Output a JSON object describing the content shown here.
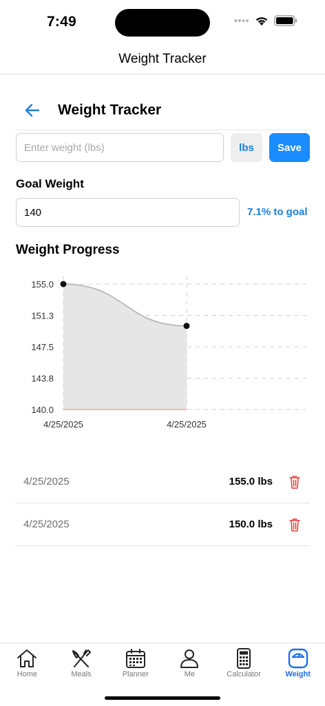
{
  "status_bar": {
    "time": "7:49"
  },
  "header": {
    "title": "Weight Tracker"
  },
  "page": {
    "title": "Weight Tracker"
  },
  "weight_entry": {
    "placeholder": "Enter weight (lbs)",
    "unit_label": "lbs",
    "save_label": "Save"
  },
  "goal": {
    "label": "Goal Weight",
    "value": "140",
    "progress_text": "7.1% to goal"
  },
  "chart_title": "Weight Progress",
  "chart_data": {
    "type": "line",
    "x": [
      "4/25/2025",
      "4/25/2025"
    ],
    "values": [
      155.0,
      150.0
    ],
    "goal_line": 140.0,
    "y_ticks": [
      "155.0",
      "151.3",
      "147.5",
      "143.8",
      "140.0"
    ],
    "ylim": [
      140.0,
      155.0
    ],
    "grid": true,
    "line_color": "#bdbdbd",
    "fill_color": "#e6e6e6",
    "point_color": "#111111",
    "goal_line_color": "#ff9a9a"
  },
  "entries": [
    {
      "date": "4/25/2025",
      "weight": "155.0 lbs"
    },
    {
      "date": "4/25/2025",
      "weight": "150.0 lbs"
    }
  ],
  "tabs": [
    {
      "label": "Home",
      "icon": "home-icon"
    },
    {
      "label": "Meals",
      "icon": "fork-knife-icon"
    },
    {
      "label": "Planner",
      "icon": "calendar-icon"
    },
    {
      "label": "Me",
      "icon": "person-icon"
    },
    {
      "label": "Calculator",
      "icon": "calculator-icon"
    },
    {
      "label": "Weight",
      "icon": "scale-icon",
      "active": true
    }
  ],
  "colors": {
    "accent": "#1a8cff",
    "accent_text": "#1a7fe0",
    "delete": "#e53935"
  }
}
